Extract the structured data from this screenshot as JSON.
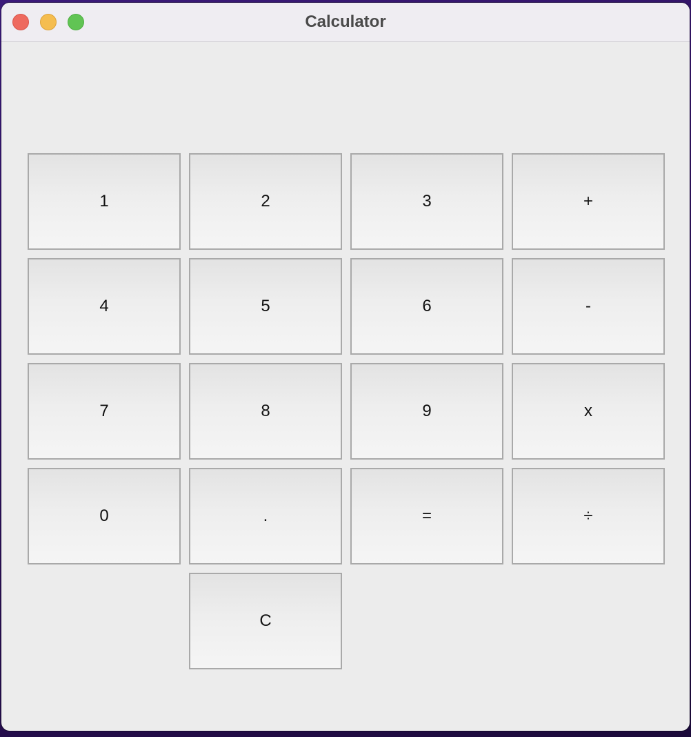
{
  "window": {
    "title": "Calculator",
    "controls": [
      "close-icon",
      "minimize-icon",
      "zoom-icon"
    ]
  },
  "display": {
    "value": ""
  },
  "keypad": {
    "row1": [
      "1",
      "2",
      "3",
      "+"
    ],
    "row2": [
      "4",
      "5",
      "6",
      "-"
    ],
    "row3": [
      "7",
      "8",
      "9",
      "x"
    ],
    "row4": [
      "0",
      ".",
      "=",
      "÷"
    ],
    "row5": [
      "C"
    ]
  },
  "colors": {
    "window_bg": "#ececec",
    "titlebar_bg": "#efedf2",
    "close": "#ee6a5f",
    "minimize": "#f5bd4f",
    "zoom": "#61c454",
    "key_border": "#a9a9a9"
  }
}
